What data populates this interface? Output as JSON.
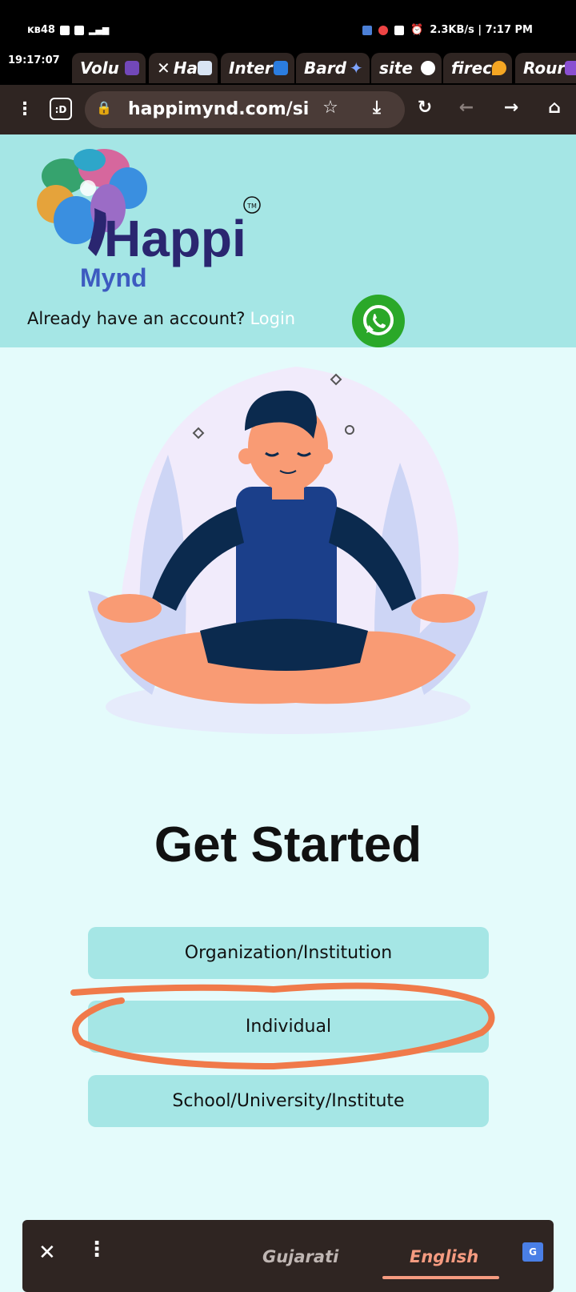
{
  "status_bar": {
    "left_text": "ᴋʙ48",
    "right_text": "2.3KB/s | 7:17 PM"
  },
  "tabs": {
    "time": "19:17:07",
    "items": [
      {
        "label": "Volu",
        "icon": "forms-icon"
      },
      {
        "label": "Ha",
        "icon": "happimynd-icon"
      },
      {
        "label": "Inter",
        "icon": "is-icon"
      },
      {
        "label": "Bard",
        "icon": "bard-sparkle-icon"
      },
      {
        "label": "site",
        "icon": "google-icon"
      },
      {
        "label": "firec",
        "icon": "firebase-icon"
      },
      {
        "label": "Rour",
        "icon": "app-icon"
      }
    ]
  },
  "browser": {
    "url": "happimynd.com/si"
  },
  "header": {
    "brand_main": "Happi",
    "brand_sub": "Mynd",
    "trademark": "TM",
    "account_prompt": "Already have an account?",
    "login_link": "Login"
  },
  "main": {
    "title": "Get Started",
    "choices": [
      "Organization/Institution",
      "Individual",
      "School/University/Institute"
    ]
  },
  "translate_bar": {
    "source_language": "Gujarati",
    "target_language": "English",
    "translate_icon_text": "G"
  },
  "colors": {
    "header_bg": "#a5e6e5",
    "page_bg": "#e4fbfb",
    "button_bg": "#a5e6e5",
    "annotation": "#f07a4a",
    "whatsapp": "#2aa829"
  }
}
